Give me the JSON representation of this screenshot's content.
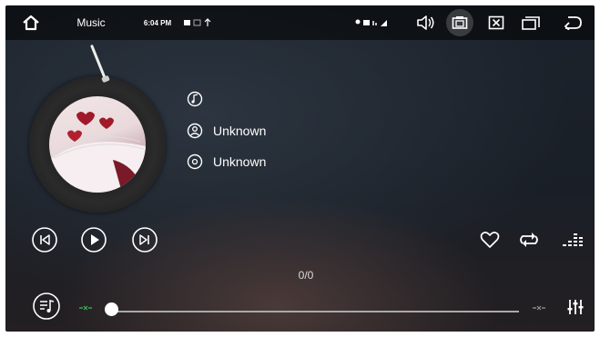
{
  "statusbar": {
    "app_title": "Music",
    "time": "6:04 PM"
  },
  "track": {
    "title": "",
    "artist": "Unknown",
    "album": "Unknown"
  },
  "playback": {
    "counter": "0/0",
    "progress": 0
  },
  "icons": {
    "home": "home-icon",
    "volume": "volume-icon",
    "screenshot": "screenshot-icon",
    "close_app": "close-app-icon",
    "recent": "recent-apps-icon",
    "back": "back-icon",
    "prev": "skip-previous-icon",
    "play": "play-icon",
    "next": "skip-next-icon",
    "favorite": "heart-icon",
    "repeat": "repeat-icon",
    "eq_bars": "equalizer-bars-icon",
    "playlist": "playlist-icon",
    "equalizer": "equalizer-sliders-icon"
  },
  "colors": {
    "accent_green": "#3cbf5a"
  }
}
